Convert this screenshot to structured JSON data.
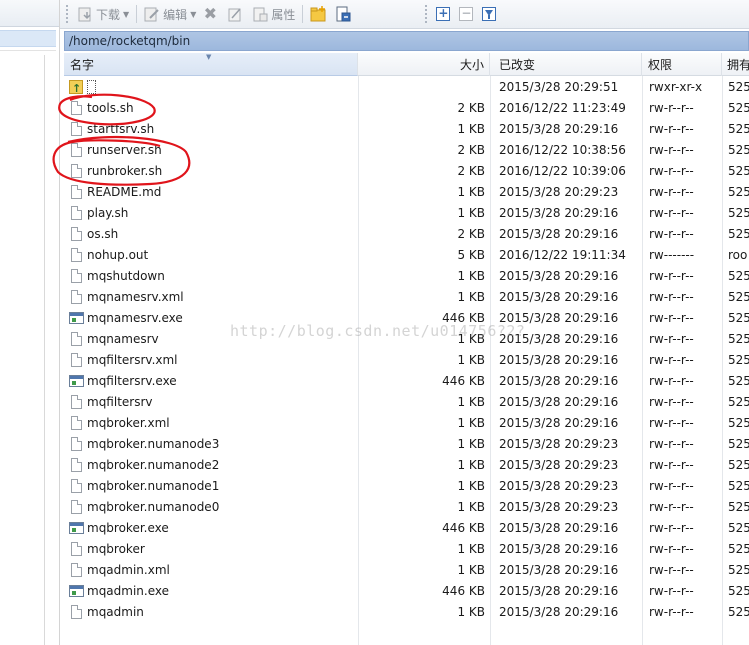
{
  "toolbar": {
    "download_label": "下载",
    "edit_label": "编辑",
    "properties_label": "属性"
  },
  "path": "/home/rocketqm/bin",
  "columns": {
    "name": "名字",
    "size": "大小",
    "modified": "已改变",
    "permissions": "权限",
    "owner": "拥有"
  },
  "parent_row": {
    "date": "2015/3/28 20:29:51",
    "perm": "rwxr-xr-x",
    "owner": "525"
  },
  "files": [
    {
      "name": "tools.sh",
      "size": "2 KB",
      "date": "2016/12/22 11:23:49",
      "perm": "rw-r--r--",
      "owner": "525",
      "icon": "file-icon"
    },
    {
      "name": "startfsrv.sh",
      "size": "1 KB",
      "date": "2015/3/28 20:29:16",
      "perm": "rw-r--r--",
      "owner": "525",
      "icon": "file-icon"
    },
    {
      "name": "runserver.sh",
      "size": "2 KB",
      "date": "2016/12/22 10:38:56",
      "perm": "rw-r--r--",
      "owner": "525",
      "icon": "file-icon"
    },
    {
      "name": "runbroker.sh",
      "size": "2 KB",
      "date": "2016/12/22 10:39:06",
      "perm": "rw-r--r--",
      "owner": "525",
      "icon": "file-icon"
    },
    {
      "name": "README.md",
      "size": "1 KB",
      "date": "2015/3/28 20:29:23",
      "perm": "rw-r--r--",
      "owner": "525",
      "icon": "file-icon"
    },
    {
      "name": "play.sh",
      "size": "1 KB",
      "date": "2015/3/28 20:29:16",
      "perm": "rw-r--r--",
      "owner": "525",
      "icon": "file-icon"
    },
    {
      "name": "os.sh",
      "size": "2 KB",
      "date": "2015/3/28 20:29:16",
      "perm": "rw-r--r--",
      "owner": "525",
      "icon": "file-icon"
    },
    {
      "name": "nohup.out",
      "size": "5 KB",
      "date": "2016/12/22 19:11:34",
      "perm": "rw-------",
      "owner": "roo",
      "icon": "file-icon"
    },
    {
      "name": "mqshutdown",
      "size": "1 KB",
      "date": "2015/3/28 20:29:16",
      "perm": "rw-r--r--",
      "owner": "525",
      "icon": "file-icon"
    },
    {
      "name": "mqnamesrv.xml",
      "size": "1 KB",
      "date": "2015/3/28 20:29:16",
      "perm": "rw-r--r--",
      "owner": "525",
      "icon": "file-icon"
    },
    {
      "name": "mqnamesrv.exe",
      "size": "446 KB",
      "date": "2015/3/28 20:29:16",
      "perm": "rw-r--r--",
      "owner": "525",
      "icon": "exe-icon"
    },
    {
      "name": "mqnamesrv",
      "size": "1 KB",
      "date": "2015/3/28 20:29:16",
      "perm": "rw-r--r--",
      "owner": "525",
      "icon": "file-icon"
    },
    {
      "name": "mqfiltersrv.xml",
      "size": "1 KB",
      "date": "2015/3/28 20:29:16",
      "perm": "rw-r--r--",
      "owner": "525",
      "icon": "file-icon"
    },
    {
      "name": "mqfiltersrv.exe",
      "size": "446 KB",
      "date": "2015/3/28 20:29:16",
      "perm": "rw-r--r--",
      "owner": "525",
      "icon": "exe-icon"
    },
    {
      "name": "mqfiltersrv",
      "size": "1 KB",
      "date": "2015/3/28 20:29:16",
      "perm": "rw-r--r--",
      "owner": "525",
      "icon": "file-icon"
    },
    {
      "name": "mqbroker.xml",
      "size": "1 KB",
      "date": "2015/3/28 20:29:16",
      "perm": "rw-r--r--",
      "owner": "525",
      "icon": "file-icon"
    },
    {
      "name": "mqbroker.numanode3",
      "size": "1 KB",
      "date": "2015/3/28 20:29:23",
      "perm": "rw-r--r--",
      "owner": "525",
      "icon": "file-icon"
    },
    {
      "name": "mqbroker.numanode2",
      "size": "1 KB",
      "date": "2015/3/28 20:29:23",
      "perm": "rw-r--r--",
      "owner": "525",
      "icon": "file-icon"
    },
    {
      "name": "mqbroker.numanode1",
      "size": "1 KB",
      "date": "2015/3/28 20:29:23",
      "perm": "rw-r--r--",
      "owner": "525",
      "icon": "file-icon"
    },
    {
      "name": "mqbroker.numanode0",
      "size": "1 KB",
      "date": "2015/3/28 20:29:23",
      "perm": "rw-r--r--",
      "owner": "525",
      "icon": "file-icon"
    },
    {
      "name": "mqbroker.exe",
      "size": "446 KB",
      "date": "2015/3/28 20:29:16",
      "perm": "rw-r--r--",
      "owner": "525",
      "icon": "exe-icon"
    },
    {
      "name": "mqbroker",
      "size": "1 KB",
      "date": "2015/3/28 20:29:16",
      "perm": "rw-r--r--",
      "owner": "525",
      "icon": "file-icon"
    },
    {
      "name": "mqadmin.xml",
      "size": "1 KB",
      "date": "2015/3/28 20:29:16",
      "perm": "rw-r--r--",
      "owner": "525",
      "icon": "file-icon"
    },
    {
      "name": "mqadmin.exe",
      "size": "446 KB",
      "date": "2015/3/28 20:29:16",
      "perm": "rw-r--r--",
      "owner": "525",
      "icon": "exe-icon"
    },
    {
      "name": "mqadmin",
      "size": "1 KB",
      "date": "2015/3/28 20:29:16",
      "perm": "rw-r--r--",
      "owner": "525",
      "icon": "file-icon"
    }
  ],
  "watermark": "http://blog.csdn.net/u014756?2?",
  "colors": {
    "path_bar": "#a6c0e2",
    "annotation": "#e0141b"
  }
}
